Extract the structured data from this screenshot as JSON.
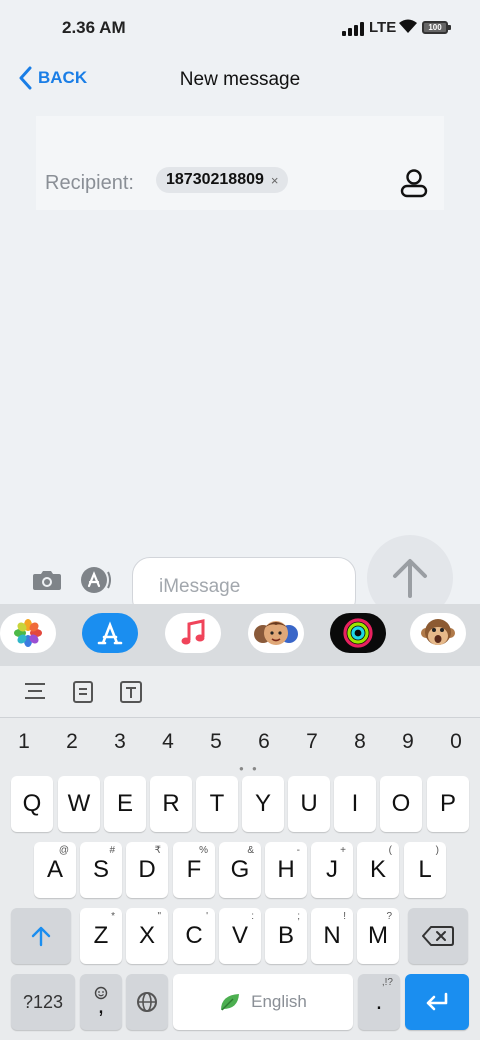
{
  "status": {
    "time": "2.36 AM",
    "network": "LTE",
    "battery": "100"
  },
  "nav": {
    "back_label": "BACK",
    "title": "New message"
  },
  "recipient": {
    "label": "Recipient:",
    "chip_number": "18730218809",
    "remove_glyph": "×"
  },
  "compose": {
    "placeholder": "iMessage"
  },
  "keyboard": {
    "numbers": [
      "1",
      "2",
      "3",
      "4",
      "5",
      "6",
      "7",
      "8",
      "9",
      "0"
    ],
    "row1": [
      "Q",
      "W",
      "E",
      "R",
      "T",
      "Y",
      "U",
      "I",
      "O",
      "P"
    ],
    "row2": [
      "A",
      "S",
      "D",
      "F",
      "G",
      "H",
      "J",
      "K",
      "L"
    ],
    "row2_sup": [
      "@",
      "#",
      "₹",
      "%",
      "&",
      "-",
      "+",
      "(",
      ")"
    ],
    "row3": [
      "Z",
      "X",
      "C",
      "V",
      "B",
      "N",
      "M"
    ],
    "row3_sup": [
      "*",
      "\"",
      "'",
      ":",
      ";",
      "!",
      "?"
    ],
    "symbols_label": "?123",
    "comma_label": ",",
    "space_label": "English",
    "period_label": ".",
    "period_sup": ",!?"
  },
  "colors": {
    "accent": "#1a7ee6",
    "enter_key": "#1a8ef0",
    "background": "#eef1f4"
  },
  "icons": [
    "chevron-left-icon",
    "contact-icon",
    "camera-icon",
    "app-store-icon",
    "up-arrow-icon",
    "photos-icon",
    "music-icon",
    "memoji-icon",
    "activity-icon",
    "monkey-icon",
    "align-icon",
    "clipboard-icon",
    "text-icon",
    "shift-icon",
    "backspace-icon",
    "emoji-icon",
    "globe-icon",
    "leaf-icon",
    "enter-icon"
  ]
}
